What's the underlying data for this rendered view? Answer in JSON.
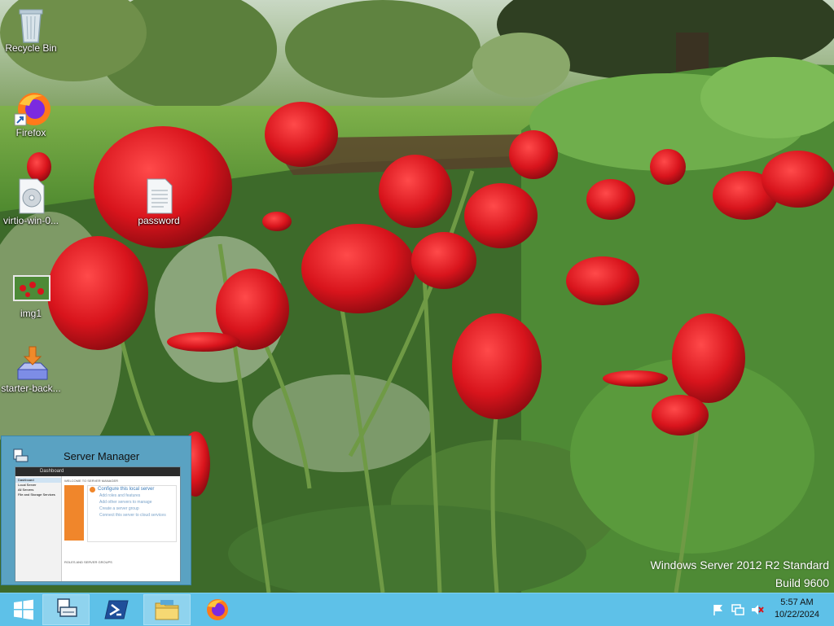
{
  "desktop": {
    "icons": [
      {
        "label": "Recycle Bin",
        "icon": "recycle-bin-icon"
      },
      {
        "label": "Firefox",
        "icon": "firefox-icon"
      },
      {
        "label": "virtio-win-0...",
        "icon": "disc-image-icon"
      },
      {
        "label": "password",
        "icon": "text-file-icon"
      },
      {
        "label": "img1",
        "icon": "image-file-icon"
      },
      {
        "label": "starter-back...",
        "icon": "installer-icon"
      }
    ]
  },
  "watermark": {
    "line1": "Windows Server 2012 R2 Standard",
    "line2": "Build 9600"
  },
  "taskbar_preview": {
    "title": "Server Manager",
    "inner": {
      "breadcrumb": "Dashboard",
      "welcome": "WELCOME TO SERVER MANAGER",
      "configure": "Configure this local server",
      "steps": [
        "Add roles and features",
        "Add other servers to manage",
        "Create a server group",
        "Connect this server to cloud services"
      ],
      "sidebar": [
        "Dashboard",
        "Local Server",
        "All Servers",
        "File and Storage Services"
      ],
      "footer": "ROLES AND SERVER GROUPS"
    }
  },
  "taskbar": {
    "buttons": [
      {
        "name": "start",
        "icon": "windows-logo-icon"
      },
      {
        "name": "server-manager",
        "icon": "server-manager-icon"
      },
      {
        "name": "powershell",
        "icon": "powershell-icon"
      },
      {
        "name": "file-explorer",
        "icon": "folder-icon"
      },
      {
        "name": "firefox",
        "icon": "firefox-icon"
      }
    ],
    "time": "5:57 AM",
    "date": "10/22/2024"
  },
  "colors": {
    "taskbar": "#5ec1e8",
    "preview": "#5aa2c2",
    "accent_orange": "#f0862b"
  }
}
